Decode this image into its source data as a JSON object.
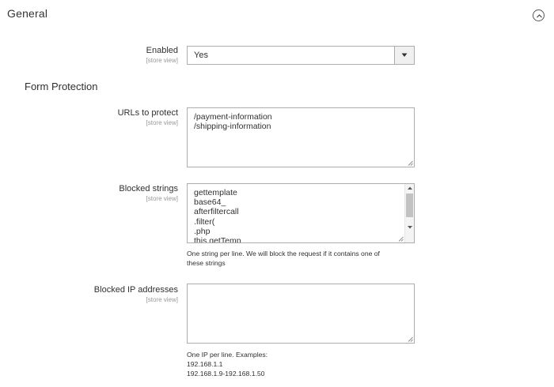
{
  "section": {
    "title": "General",
    "collapse_icon": "chevron-up-circle-icon"
  },
  "enabled": {
    "label": "Enabled",
    "scope": "[store view]",
    "value": "Yes",
    "dropdown_icon": "caret-down-icon"
  },
  "form_protection": {
    "title": "Form Protection"
  },
  "urls": {
    "label": "URLs to protect",
    "scope": "[store view]",
    "lines": [
      "/payment-information",
      "/shipping-information"
    ]
  },
  "blocked_strings": {
    "label": "Blocked strings",
    "scope": "[store view]",
    "lines": [
      "gettemplate",
      "base64_",
      "afterfiltercall",
      ".filter(",
      ".php",
      "this.getTemp"
    ],
    "note_lines": [
      "One string per line. We will block the request if it contains one of",
      "these strings"
    ]
  },
  "blocked_ips": {
    "label": "Blocked IP addresses",
    "scope": "[store view]",
    "value": "",
    "note_lines": [
      "One IP per line. Examples:",
      "192.168.1.1",
      "192.168.1.9-192.168.1.50"
    ]
  }
}
